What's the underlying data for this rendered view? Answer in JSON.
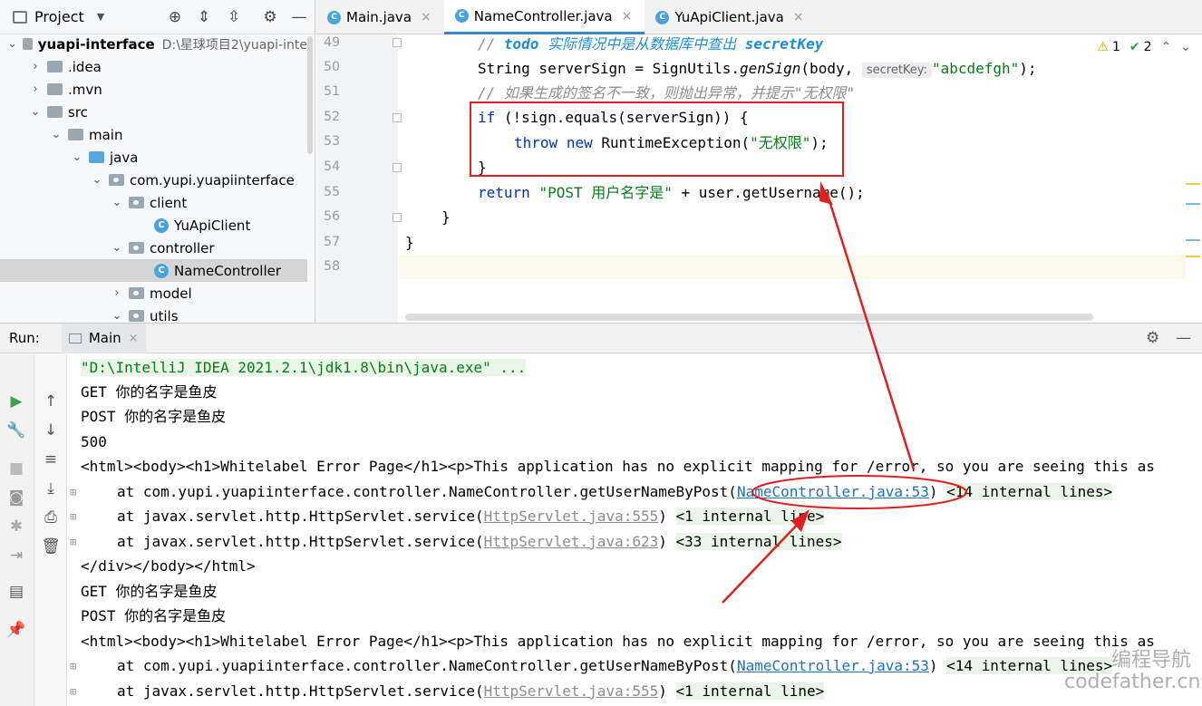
{
  "project": {
    "title": "Project",
    "root_name": "yuapi-interface",
    "root_path": "D:\\星球项目2\\yuapi-inte",
    "tree": [
      {
        "label": "yuapi-interface"
      },
      {
        "label": ".idea"
      },
      {
        "label": ".mvn"
      },
      {
        "label": "src"
      },
      {
        "label": "main"
      },
      {
        "label": "java"
      },
      {
        "label": "com.yupi.yuapiinterface"
      },
      {
        "label": "client"
      },
      {
        "label": "YuApiClient"
      },
      {
        "label": "controller"
      },
      {
        "label": "NameController"
      },
      {
        "label": "model"
      },
      {
        "label": "utils"
      }
    ]
  },
  "editor": {
    "tabs": [
      {
        "label": "Main.java"
      },
      {
        "label": "NameController.java"
      },
      {
        "label": "YuApiClient.java"
      }
    ],
    "inspections": {
      "warnings": "1",
      "ok": "2"
    },
    "line_numbers": [
      "49",
      "50",
      "51",
      "52",
      "53",
      "54",
      "55",
      "56",
      "57",
      "58"
    ],
    "code": {
      "l49_slashes": "// ",
      "l49_todo": "todo",
      "l49_text": " 实际情况中是从数据库中查出 ",
      "l49_var": "secretKey",
      "l50_a": "String serverSign = SignUtils.",
      "l50_method": "genSign",
      "l50_b": "(body, ",
      "l50_hint": "secretKey:",
      "l50_str": "\"abcdefgh\"",
      "l50_c": ");",
      "l51_comment": "// 如果生成的签名不一致，则抛出异常，并提示\"无权限\"",
      "l52_kw": "if",
      "l52_rest": " (!sign.equals(serverSign)) {",
      "l53_kw1": "throw",
      "l53_kw2": "new",
      "l53_a": " RuntimeException(",
      "l53_str": "\"无权限\"",
      "l53_b": ");",
      "l54": "}",
      "l55_kw": "return",
      "l55_str": "\"POST 用户名字是\"",
      "l55_rest": " + user.getUsername();",
      "l56": "}",
      "l57": "}"
    }
  },
  "run": {
    "label": "Run:",
    "tab": "Main",
    "console": {
      "cmd": "\"D:\\IntelliJ IDEA 2021.2.1\\jdk1.8\\bin\\java.exe\" ...",
      "get1": "GET 你的名字是鱼皮",
      "post1": "POST 你的名字是鱼皮",
      "code500": "500",
      "html1": "<html><body><h1>Whitelabel Error Page</h1><p>This application has no explicit mapping for /error, so you are seeing this as",
      "at1_prefix": "at com.yupi.yuapiinterface.controller.NameController.getUserNameByPost(",
      "at1_link": "NameController.java:53",
      "at1_suffix": ")",
      "at1_internal": "<14 internal lines>",
      "at2_prefix": "at javax.servlet.http.HttpServlet.service(",
      "at2_link": "HttpServlet.java:555",
      "at2_suffix": ")",
      "at2_internal": "<1 internal line>",
      "at3_prefix": "at javax.servlet.http.HttpServlet.service(",
      "at3_link": "HttpServlet.java:623",
      "at3_suffix": ")",
      "at3_internal": "<33 internal lines>",
      "close": "</div></body></html>",
      "get2": "GET 你的名字是鱼皮",
      "post2": "POST 你的名字是鱼皮",
      "html2": "<html><body><h1>Whitelabel Error Page</h1><p>This application has no explicit mapping for /error, so you are seeing this as",
      "at4_prefix": "at com.yupi.yuapiinterface.controller.NameController.getUserNameByPost(",
      "at4_link": "NameController.java:53",
      "at4_suffix": ")",
      "at4_internal": "<14 internal lines>",
      "at5_prefix": "at javax.servlet.http.HttpServlet.service(",
      "at5_link": "HttpServlet.java:555",
      "at5_suffix": ")",
      "at5_internal": "<1 internal line>"
    }
  },
  "watermark": {
    "line1": "编程导航",
    "line2": "codefather.cn"
  },
  "colors": {
    "annotation": "#e02020",
    "keyword": "#0033b3",
    "string": "#067d17",
    "link": "#2470b3"
  },
  "icons": [
    "project-icon",
    "locate-icon",
    "expand-all-icon",
    "collapse-all-icon",
    "gear-icon",
    "minimize-icon",
    "run-icon",
    "wrench-icon",
    "stop-icon",
    "camera-icon",
    "debug-icon",
    "login-icon",
    "layout-icon",
    "pin-icon",
    "up-arrow-icon",
    "down-arrow-icon",
    "soft-wrap-icon",
    "scroll-to-end-icon",
    "print-icon",
    "trash-icon"
  ]
}
